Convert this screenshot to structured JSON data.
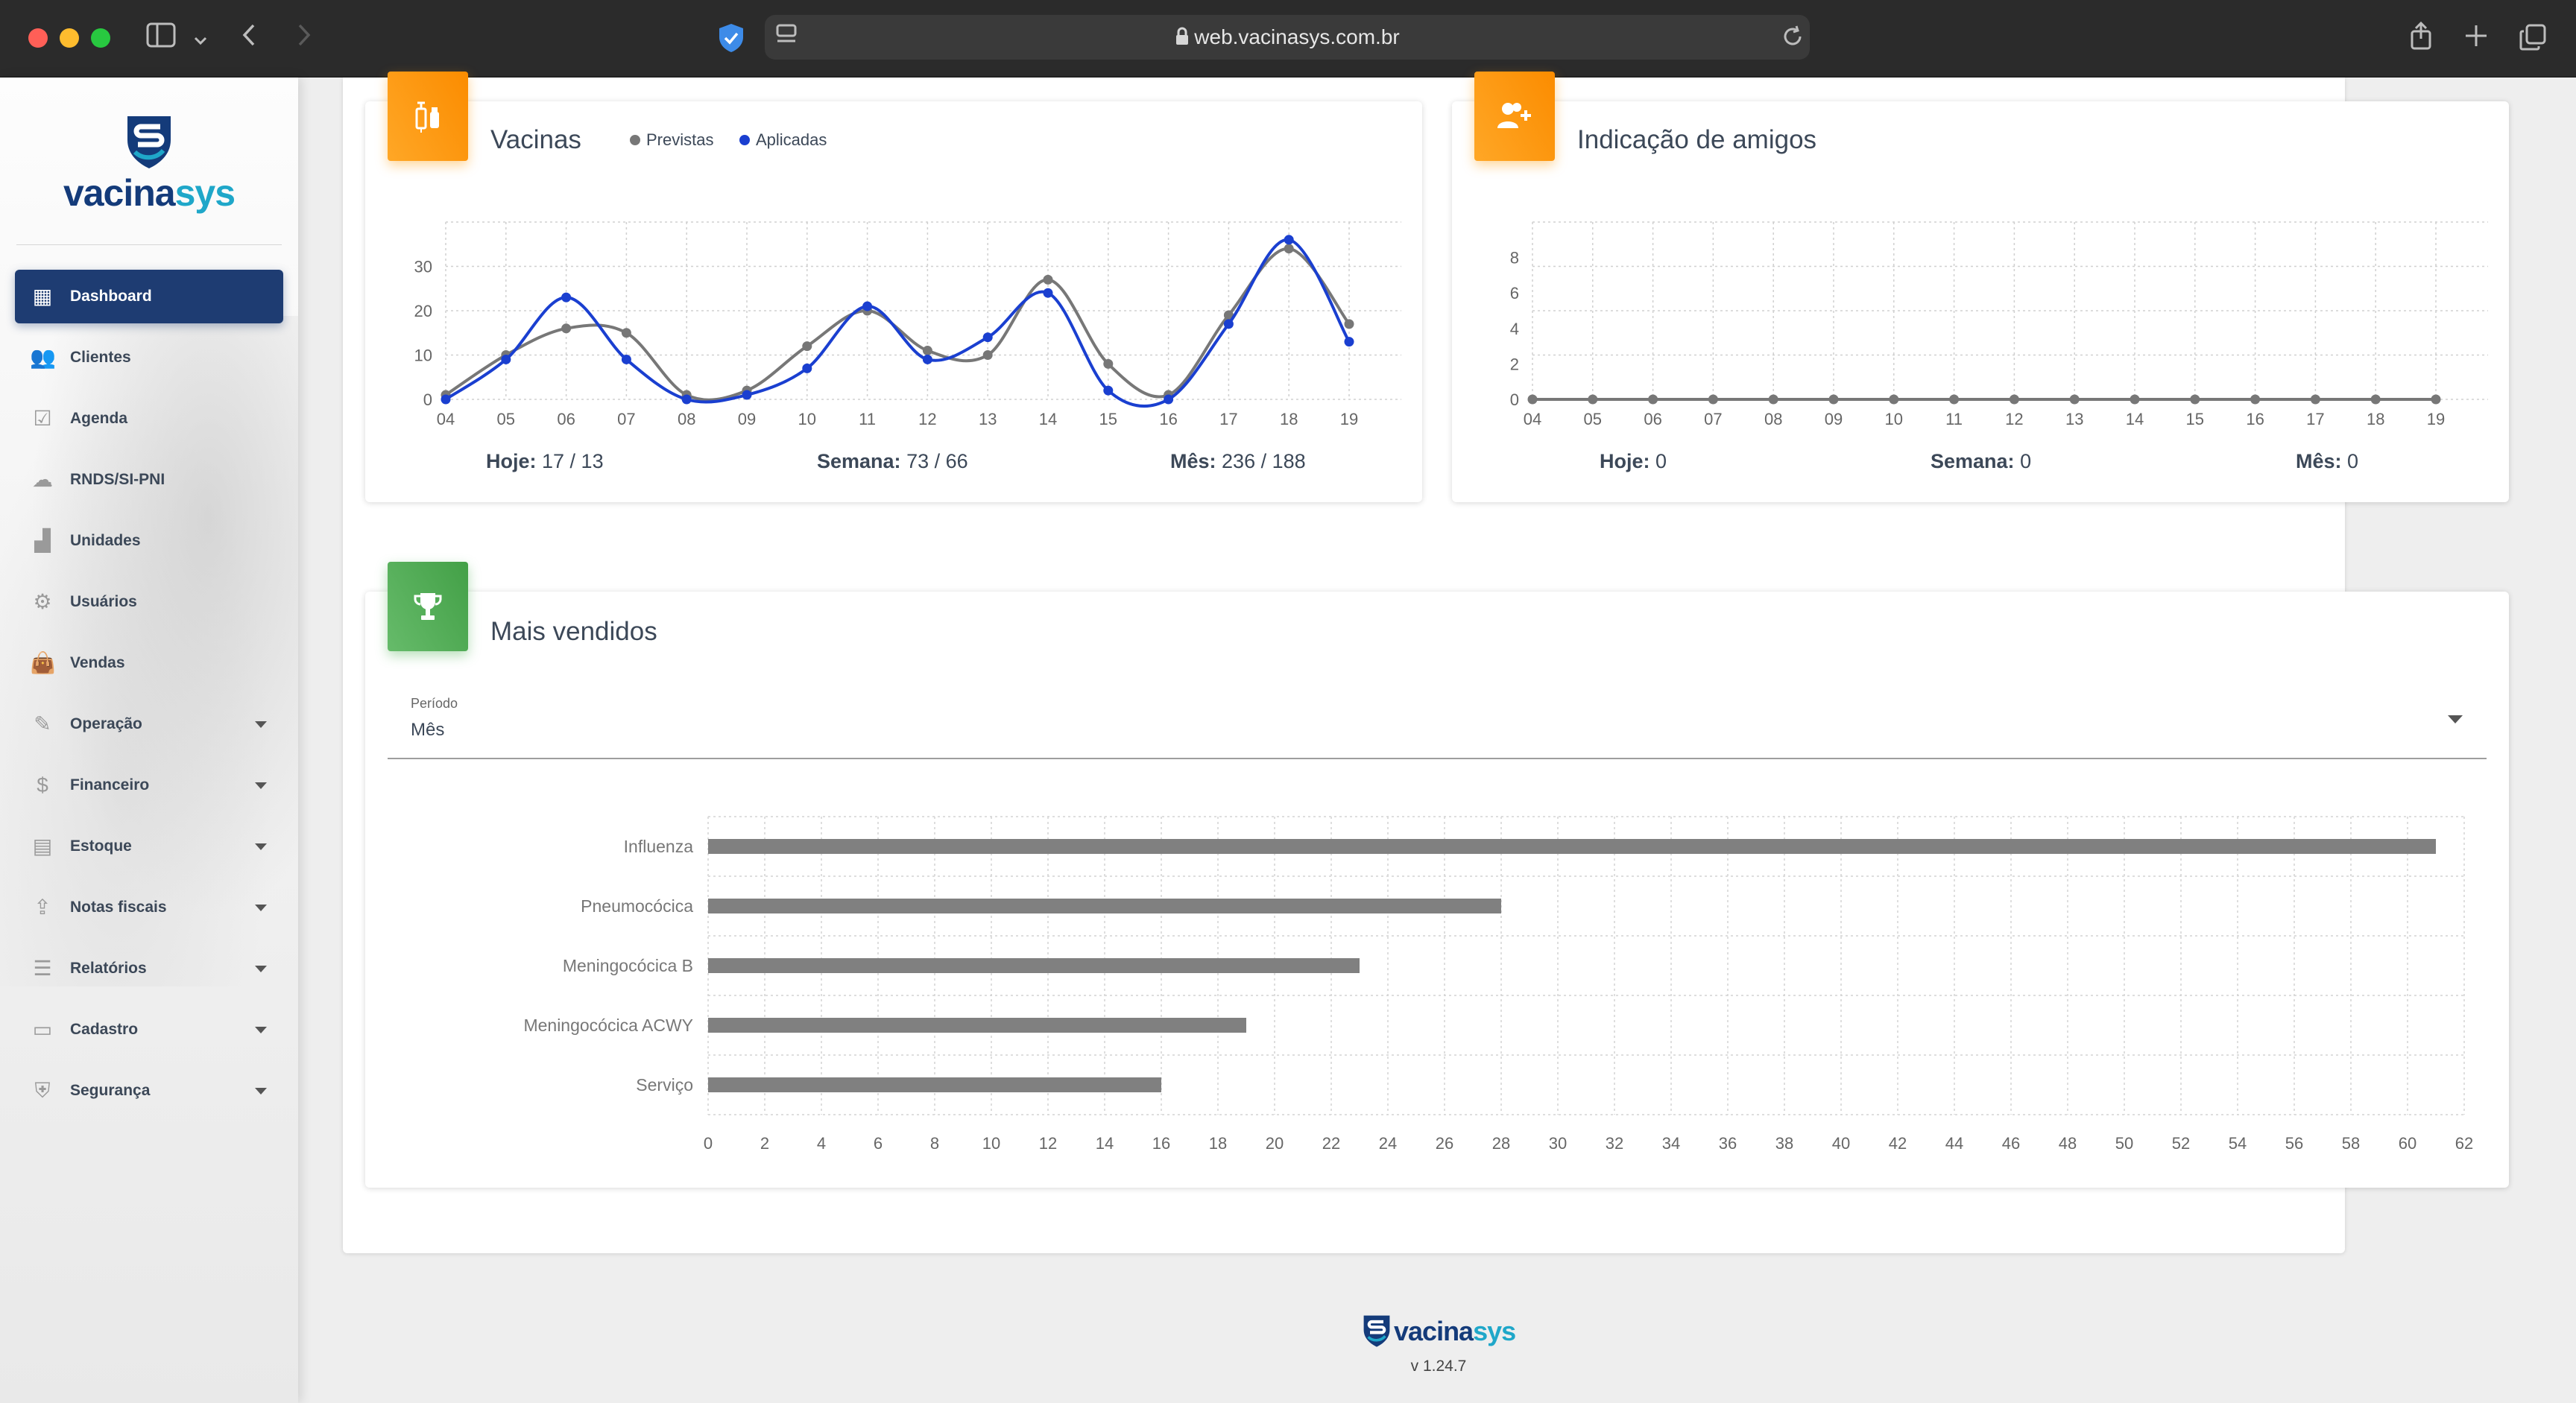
{
  "browser": {
    "url": "web.vacinasys.com.br",
    "colors": {
      "close": "#ff5f57",
      "minimize": "#febc2e",
      "maximize": "#28c840"
    }
  },
  "sidebar": {
    "logo": {
      "part1": "vacina",
      "part2": "sys"
    },
    "items": [
      {
        "label": "Dashboard",
        "icon": "dashboard-icon",
        "active": true,
        "expandable": false
      },
      {
        "label": "Clientes",
        "icon": "people-icon",
        "active": false,
        "expandable": false
      },
      {
        "label": "Agenda",
        "icon": "calendar-check-icon",
        "active": false,
        "expandable": false
      },
      {
        "label": "RNDS/SI-PNI",
        "icon": "cloud-upload-icon",
        "active": false,
        "expandable": false
      },
      {
        "label": "Unidades",
        "icon": "building-icon",
        "active": false,
        "expandable": false
      },
      {
        "label": "Usuários",
        "icon": "user-settings-icon",
        "active": false,
        "expandable": false
      },
      {
        "label": "Vendas",
        "icon": "shopping-bag-icon",
        "active": false,
        "expandable": false
      },
      {
        "label": "Operação",
        "icon": "edit-icon",
        "active": false,
        "expandable": true
      },
      {
        "label": "Financeiro",
        "icon": "dollar-icon",
        "active": false,
        "expandable": true
      },
      {
        "label": "Estoque",
        "icon": "archive-icon",
        "active": false,
        "expandable": true
      },
      {
        "label": "Notas fiscais",
        "icon": "upload-icon",
        "active": false,
        "expandable": true
      },
      {
        "label": "Relatórios",
        "icon": "list-icon",
        "active": false,
        "expandable": true
      },
      {
        "label": "Cadastro",
        "icon": "folder-icon",
        "active": false,
        "expandable": true
      },
      {
        "label": "Segurança",
        "icon": "shield-icon",
        "active": false,
        "expandable": true
      }
    ]
  },
  "vacinas": {
    "title": "Vacinas",
    "legend": [
      {
        "label": "Previstas",
        "color": "#777777"
      },
      {
        "label": "Aplicadas",
        "color": "#1a3fd0"
      }
    ],
    "stats": {
      "hoje": {
        "label": "Hoje:",
        "value": "17 / 13"
      },
      "semana": {
        "label": "Semana:",
        "value": "73 / 66"
      },
      "mes": {
        "label": "Mês:",
        "value": "236 / 188"
      }
    }
  },
  "amigos": {
    "title": "Indicação de amigos",
    "stats": {
      "hoje": {
        "label": "Hoje:",
        "value": "0"
      },
      "semana": {
        "label": "Semana:",
        "value": "0"
      },
      "mes": {
        "label": "Mês:",
        "value": "0"
      }
    }
  },
  "vendidos": {
    "title": "Mais vendidos",
    "period_label": "Período",
    "period_value": "Mês"
  },
  "footer": {
    "logo": {
      "part1": "vacina",
      "part2": "sys"
    },
    "version": "v 1.24.7"
  },
  "chart_data": [
    {
      "type": "line",
      "title": "Vacinas",
      "x": [
        "04",
        "05",
        "06",
        "07",
        "08",
        "09",
        "10",
        "11",
        "12",
        "13",
        "14",
        "15",
        "16",
        "17",
        "18",
        "19"
      ],
      "yticks": [
        0,
        10,
        20,
        30
      ],
      "ylim": [
        0,
        40
      ],
      "grid": true,
      "legend_position": "top",
      "series": [
        {
          "name": "Previstas",
          "color": "#777777",
          "values": [
            1,
            10,
            16,
            15,
            1,
            2,
            12,
            20,
            11,
            10,
            27,
            8,
            1,
            19,
            34,
            17
          ]
        },
        {
          "name": "Aplicadas",
          "color": "#1a3fd0",
          "values": [
            0,
            9,
            23,
            9,
            0,
            1,
            7,
            21,
            9,
            14,
            24,
            2,
            0,
            17,
            36,
            13
          ]
        }
      ]
    },
    {
      "type": "line",
      "title": "Indicação de amigos",
      "x": [
        "04",
        "05",
        "06",
        "07",
        "08",
        "09",
        "10",
        "11",
        "12",
        "13",
        "14",
        "15",
        "16",
        "17",
        "18",
        "19"
      ],
      "yticks": [
        0,
        2,
        4,
        6,
        8
      ],
      "ylim": [
        0,
        10
      ],
      "grid": true,
      "series": [
        {
          "color": "#777777",
          "values": [
            0,
            0,
            0,
            0,
            0,
            0,
            0,
            0,
            0,
            0,
            0,
            0,
            0,
            0,
            0,
            0
          ]
        }
      ]
    },
    {
      "type": "bar",
      "orientation": "horizontal",
      "title": "Mais vendidos",
      "categories": [
        "Influenza",
        "Pneumocócica",
        "Meningocócica B",
        "Meningocócica ACWY",
        "Serviço"
      ],
      "values": [
        61,
        28,
        23,
        19,
        16
      ],
      "xticks": [
        0,
        2,
        4,
        6,
        8,
        10,
        12,
        14,
        16,
        18,
        20,
        22,
        24,
        26,
        28,
        30,
        32,
        34,
        36,
        38,
        40,
        42,
        44,
        46,
        48,
        50,
        52,
        54,
        56,
        58,
        60,
        62
      ],
      "xlim": [
        0,
        62
      ],
      "color": "#808080",
      "grid": true
    }
  ]
}
